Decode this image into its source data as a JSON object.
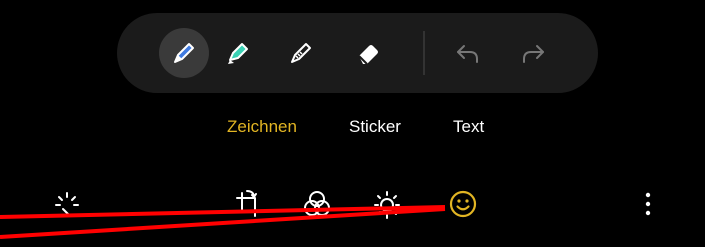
{
  "toolbar": {
    "tools": [
      {
        "icon": "pen-icon",
        "color": "#3f7ae0",
        "selected": true
      },
      {
        "icon": "highlighter-icon",
        "color": "#3ad1b4",
        "selected": false
      },
      {
        "icon": "pixel-pen-icon",
        "color": "#ffffff",
        "selected": false
      },
      {
        "icon": "eraser-icon",
        "color": "#ffffff",
        "selected": false
      }
    ],
    "history": [
      {
        "icon": "undo-icon",
        "enabled": false
      },
      {
        "icon": "redo-icon",
        "enabled": false
      }
    ]
  },
  "tabs": [
    {
      "label": "Zeichnen",
      "active": true
    },
    {
      "label": "Sticker",
      "active": false
    },
    {
      "label": "Text",
      "active": false
    }
  ],
  "bottom_bar": {
    "items": [
      {
        "icon": "auto-enhance-icon"
      },
      {
        "icon": "transform-icon"
      },
      {
        "icon": "filters-icon"
      },
      {
        "icon": "brightness-icon"
      },
      {
        "icon": "decorations-icon",
        "active": true
      },
      {
        "icon": "more-options-icon"
      }
    ]
  },
  "colors": {
    "background": "#000000",
    "toolbar_bg": "#1b1b1b",
    "accent": "#e2b523",
    "annotation_line": "#ff0000"
  }
}
